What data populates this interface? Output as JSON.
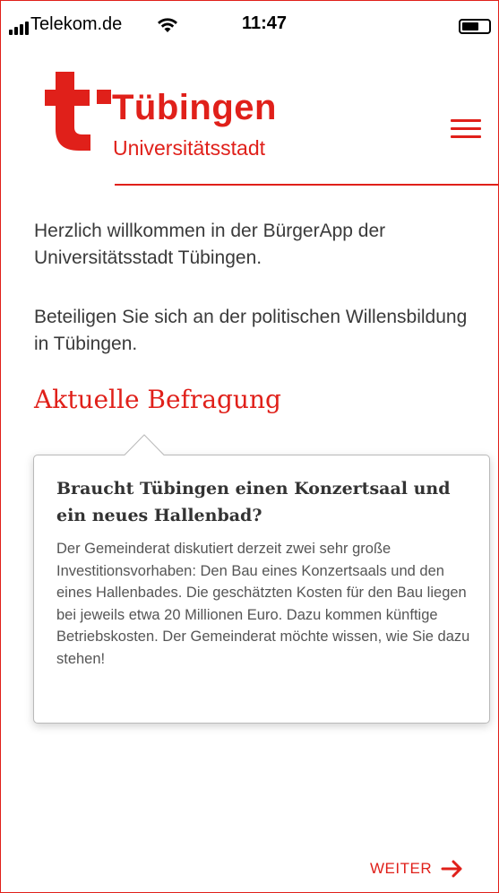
{
  "status_bar": {
    "carrier": "Telekom.de",
    "time": "11:47",
    "icons": [
      "signal-icon",
      "wifi-icon",
      "battery-icon"
    ]
  },
  "header": {
    "logo_name": "Tübingen",
    "logo_sub": "Universitätsstadt",
    "menu_icon": "hamburger-menu-icon",
    "accent_color": "#e0201a"
  },
  "intro": {
    "welcome": "Herzlich willkommen in der BürgerApp der Universitätsstadt Tübingen.",
    "participate": "Beteiligen Sie sich an der politischen Willensbildung in Tübingen."
  },
  "survey": {
    "section_title": "Aktuelle Befragung",
    "card_title": "Braucht Tübingen einen Konzertsaal und ein neues Hallenbad?",
    "card_text": "Der Gemeinderat diskutiert derzeit zwei sehr große Investitionsvorhaben: Den Bau eines Konzertsaals und den eines Hallenbades. Die geschätzten Kosten für den Bau liegen bei jeweils etwa 20 Millionen Euro. Dazu kommen künftige Betriebskosten. Der Gemeinderat möchte wissen, wie Sie dazu stehen!"
  },
  "footer": {
    "next_label": "WEITER",
    "next_icon": "arrow-right-icon"
  }
}
